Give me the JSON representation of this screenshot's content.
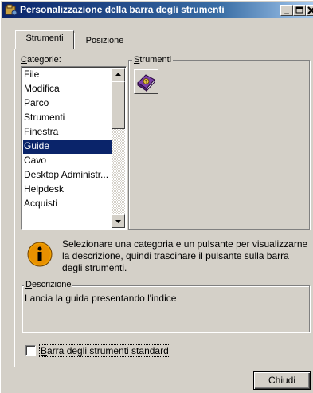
{
  "window": {
    "title": "Personalizzazione della barra degli strumenti"
  },
  "tabs": [
    {
      "label": "Strumenti",
      "active": true
    },
    {
      "label": "Posizione",
      "active": false
    }
  ],
  "categories": {
    "label": "Categorie:",
    "items": [
      "File",
      "Modifica",
      "Parco",
      "Strumenti",
      "Finestra",
      "Guide",
      "Cavo",
      "Desktop Administr...",
      "Helpdesk",
      "Acquisti"
    ],
    "selected": "Guide"
  },
  "tools": {
    "label": "Strumenti",
    "items": [
      {
        "icon": "help-book-icon"
      }
    ]
  },
  "info": {
    "icon": "info-icon",
    "text": "Selezionare una categoria e un pulsante per visualizzarne la descrizione, quindi trascinare il pulsante sulla barra degli strumenti."
  },
  "description": {
    "label": "Descrizione",
    "text": "Lancia la guida presentando l'indice"
  },
  "standard_toolbar": {
    "label": "Barra degli strumenti standard",
    "checked": false
  },
  "buttons": {
    "close_label": "Chiudi"
  },
  "colors": {
    "selection": "#0a246a",
    "title_gradient_start": "#0a246a",
    "title_gradient_end": "#a6caf0",
    "face": "#d4d0c8"
  }
}
